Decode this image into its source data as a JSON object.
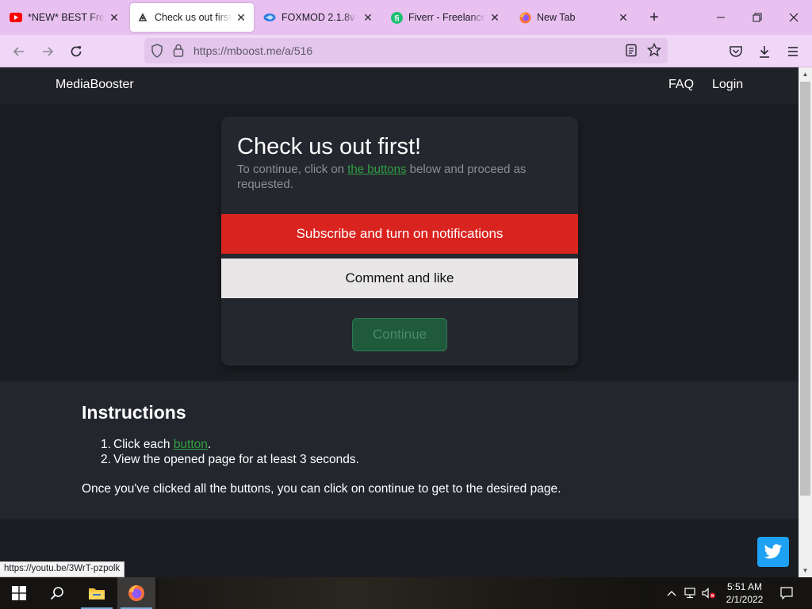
{
  "browser": {
    "tabs": [
      {
        "title": "*NEW* BEST Free Ro",
        "favicon": "youtube-icon"
      },
      {
        "title": "Check us out first! | M",
        "favicon": "mboost-icon",
        "active": true
      },
      {
        "title": "FOXMOD 2.1.8v",
        "favicon": "foxmod-icon"
      },
      {
        "title": "Fiverr - Freelance Se",
        "favicon": "fiverr-icon"
      },
      {
        "title": "New Tab",
        "favicon": "firefox-icon"
      }
    ],
    "url": "https://mboost.me/a/516"
  },
  "site": {
    "brand": "MediaBooster",
    "nav": {
      "faq": "FAQ",
      "login": "Login"
    }
  },
  "card": {
    "title": "Check us out first!",
    "text_before": "To continue, click on ",
    "text_link": "the buttons",
    "text_after": " below and proceed as requested.",
    "subscribe_label": "Subscribe and turn on notifications",
    "comment_label": "Comment and like",
    "continue_label": "Continue"
  },
  "instructions": {
    "heading": "Instructions",
    "step1_num": "1.",
    "step1_before": "Click each ",
    "step1_link": "button",
    "step1_after": ".",
    "step2_num": "2.",
    "step2": "View the opened page for at least 3 seconds.",
    "note": "Once you've clicked all the buttons, you can click on continue to get to the desired page."
  },
  "status_link": "https://youtu.be/3WrT-pzpolk",
  "taskbar": {
    "time": "5:51 AM",
    "date": "2/1/2022"
  },
  "colors": {
    "subscribe": "#d9231f",
    "comment": "#e8e6e6",
    "continue": "#1f5a3c",
    "link": "#2ea043",
    "tabbar": "#e8c1f0",
    "twitter": "#1da1f2"
  }
}
